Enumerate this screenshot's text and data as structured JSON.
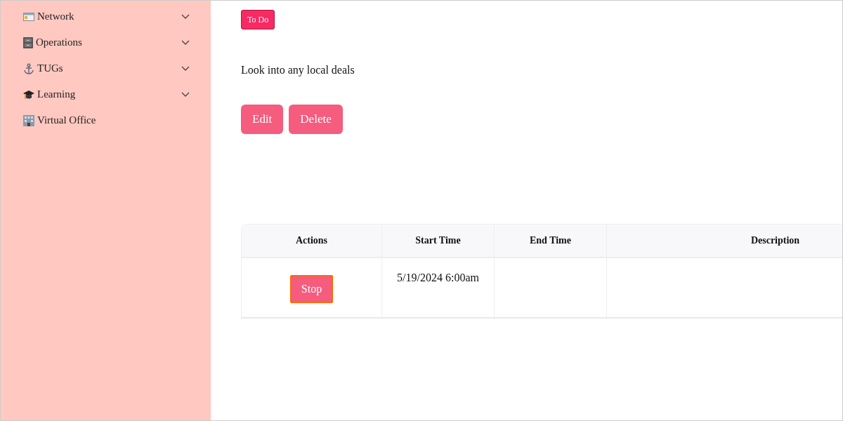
{
  "sidebar": {
    "items": [
      {
        "label": "Network",
        "kind": "group"
      },
      {
        "label": "Operations",
        "kind": "group"
      },
      {
        "label": "TUGs",
        "kind": "group"
      },
      {
        "label": "Learning",
        "kind": "group"
      },
      {
        "label": "Virtual Office",
        "kind": "link"
      }
    ]
  },
  "task": {
    "status": "To Do",
    "description": "Look into any local deals",
    "buttons": [
      "Edit",
      "Delete"
    ]
  },
  "table": {
    "columns": [
      "Actions",
      "Start Time",
      "End Time",
      "Description"
    ],
    "rows": [
      {
        "action": "Stop",
        "start_time": "5/19/2024 6:00am"
      }
    ]
  }
}
